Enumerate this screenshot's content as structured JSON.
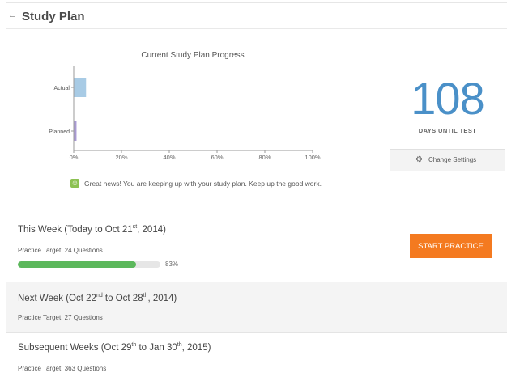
{
  "header": {
    "title": "Study Plan"
  },
  "chart_data": {
    "type": "bar",
    "orientation": "horizontal",
    "title": "Current Study Plan Progress",
    "categories": [
      "Actual",
      "Planned"
    ],
    "values": [
      5,
      1
    ],
    "xlim": [
      0,
      100
    ],
    "xticks": [
      "0%",
      "20%",
      "40%",
      "60%",
      "80%",
      "100%"
    ],
    "colors": [
      "#a8cbe5",
      "#a99ad4"
    ],
    "grid": false
  },
  "message": {
    "text": "Great news! You are keeping up with your study plan. Keep up the good work."
  },
  "days": {
    "number": "108",
    "label": "DAYS UNTIL TEST",
    "settings_label": "Change Settings"
  },
  "weeks": [
    {
      "title_a": "This Week (Today to Oct 21",
      "title_sup": "st",
      "title_b": ", 2014)",
      "target": "Practice Target: 24 Questions",
      "progress": 0.83,
      "progress_label": "83%",
      "button": "START PRACTICE"
    },
    {
      "title_a": "Next Week (Oct 22",
      "title_sup1": "nd",
      "title_mid": " to Oct 28",
      "title_sup2": "th",
      "title_b": ", 2014)",
      "target": "Practice Target: 27 Questions"
    },
    {
      "title_a": "Subsequent Weeks (Oct 29",
      "title_sup1": "th",
      "title_mid": " to Jan 30",
      "title_sup2": "th",
      "title_b": ", 2015)",
      "target": "Practice Target: 363 Questions"
    }
  ]
}
